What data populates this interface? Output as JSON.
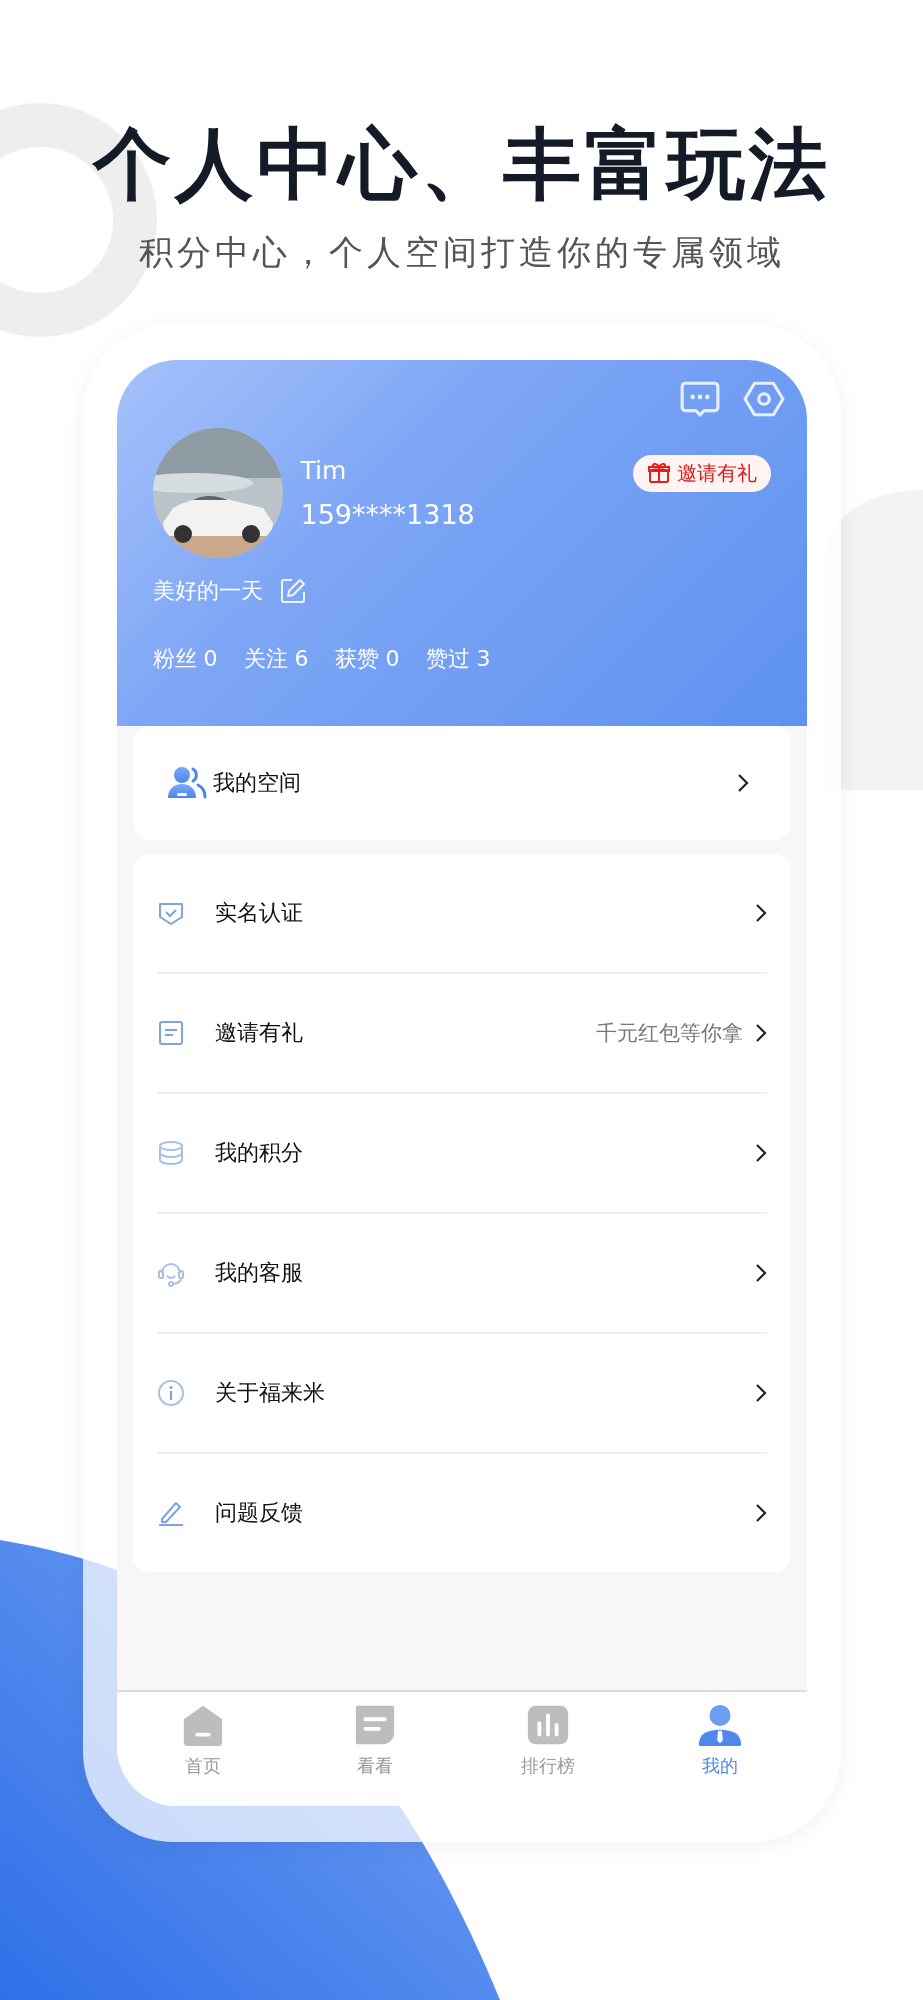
{
  "headline": "个人中心、丰富玩法",
  "subtitle": "积分中心，个人空间打造你的专属领域",
  "profile": {
    "name": "Tim",
    "phone": "159****1318",
    "bio": "美好的一天",
    "invite_badge": "邀请有礼",
    "stats": [
      "粉丝 0",
      "关注 6",
      "获赞 0",
      "赞过 3"
    ]
  },
  "space": {
    "label": "我的空间"
  },
  "menu": [
    {
      "label": "实名认证"
    },
    {
      "label": "邀请有礼",
      "note": "千元红包等你拿"
    },
    {
      "label": "我的积分"
    },
    {
      "label": "我的客服"
    },
    {
      "label": "关于福来米"
    },
    {
      "label": "问题反馈"
    }
  ],
  "tab_bar": [
    {
      "label": "首页",
      "selected": false
    },
    {
      "label": "看看",
      "selected": false
    },
    {
      "label": "排行榜",
      "selected": false
    },
    {
      "label": "我的",
      "selected": true
    }
  ]
}
